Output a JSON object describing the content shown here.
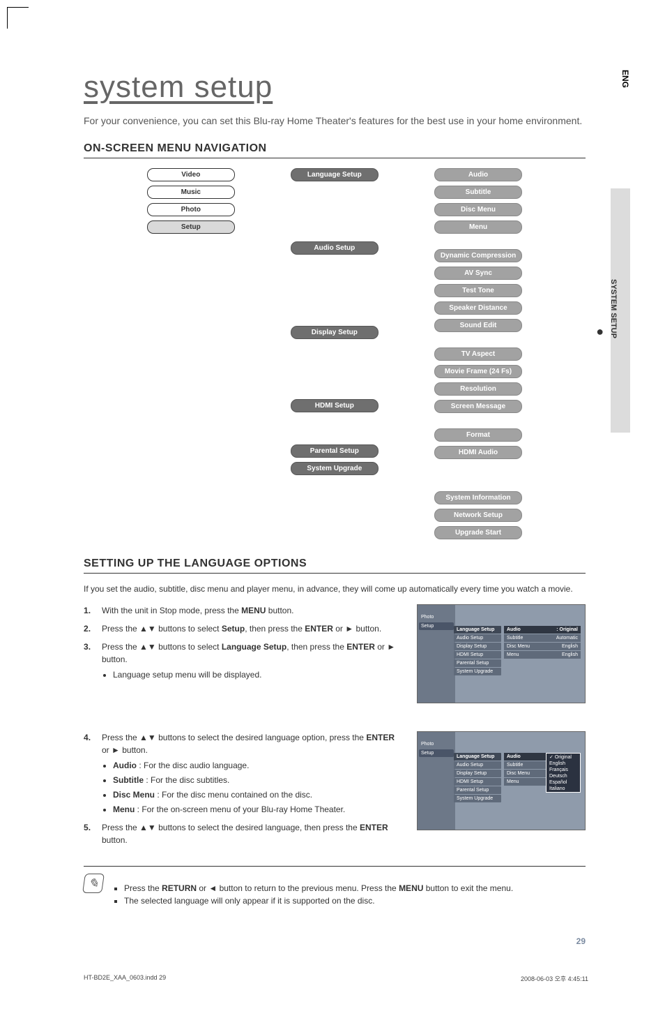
{
  "lang_tab": "ENG",
  "section_tab": "SYSTEM SETUP",
  "title": "system setup",
  "intro": "For your convenience, you can set this Blu-ray Home Theater's features for the best use in your home environment.",
  "h1": "ON-SCREEN MENU NAVIGATION",
  "nav": {
    "col1": [
      "Video",
      "Music",
      "Photo",
      "Setup"
    ],
    "col2": [
      "Language Setup",
      "Audio Setup",
      "Display Setup",
      "HDMI Setup",
      "Parental Setup",
      "System Upgrade"
    ],
    "language_items": [
      "Audio",
      "Subtitle",
      "Disc Menu",
      "Menu"
    ],
    "audio_items": [
      "Dynamic Compression",
      "AV Sync",
      "Test Tone",
      "Speaker Distance",
      "Sound Edit"
    ],
    "display_items": [
      "TV Aspect",
      "Movie Frame (24 Fs)",
      "Resolution",
      "Screen Message"
    ],
    "hdmi_items": [
      "Format",
      "HDMI Audio"
    ],
    "system_items": [
      "System Information",
      "Network Setup",
      "Upgrade Start"
    ]
  },
  "h2": "SETTING UP THE LANGUAGE OPTIONS",
  "lang_intro": "If you set the audio, subtitle, disc menu and player menu, in advance, they will come up automatically every time you watch a movie.",
  "steps": {
    "s1_a": "With the unit in Stop mode, press the ",
    "s1_b": "MENU",
    "s1_c": " button.",
    "s2_a": "Press the ▲▼ buttons to select ",
    "s2_b": "Setup",
    "s2_c": ", then press the ",
    "s2_d": "ENTER",
    "s2_e": " or ► button.",
    "s3_a": "Press the ▲▼ buttons to select ",
    "s3_b": "Language Setup",
    "s3_c": ", then press the ",
    "s3_d": "ENTER",
    "s3_e": " or ► button.",
    "s3_sub": "Language setup menu will be displayed.",
    "s4_a": "Press the ▲▼ buttons to select the desired language option, press the ",
    "s4_b": "ENTER",
    "s4_c": " or ► button.",
    "s4_sub1_b": "Audio",
    "s4_sub1_t": " : For the disc audio language.",
    "s4_sub2_b": "Subtitle",
    "s4_sub2_t": " : For the disc subtitles.",
    "s4_sub3_b": "Disc Menu",
    "s4_sub3_t": " : For the disc menu contained on the disc.",
    "s4_sub4_b": "Menu",
    "s4_sub4_t": " : For the on-screen menu of your Blu-ray Home Theater.",
    "s5_a": "Press the ▲▼ buttons to select the desired language, then press the ",
    "s5_b": "ENTER",
    "s5_c": " button."
  },
  "shot": {
    "left": [
      "Photo",
      "Setup"
    ],
    "mid": [
      "Language Setup",
      "Audio Setup",
      "Display Setup",
      "HDMI Setup",
      "Parental Setup",
      "System Upgrade"
    ],
    "right1": [
      {
        "k": "Audio",
        "v": ": Original"
      },
      {
        "k": "Subtitle",
        "v": "Automatic"
      },
      {
        "k": "Disc Menu",
        "v": "English"
      },
      {
        "k": "Menu",
        "v": "English"
      }
    ],
    "right2": [
      {
        "k": "Audio",
        "v": ""
      },
      {
        "k": "Subtitle",
        "v": ""
      },
      {
        "k": "Disc Menu",
        "v": ""
      },
      {
        "k": "Menu",
        "v": ""
      }
    ],
    "dropdown": [
      "Original",
      "English",
      "Français",
      "Deutsch",
      "Español",
      "Italiano"
    ]
  },
  "notes": {
    "n1_a": "Press the ",
    "n1_b": "RETURN",
    "n1_c": " or ◄ button to return to the previous menu. Press the ",
    "n1_d": "MENU",
    "n1_e": " button to exit the menu.",
    "n2": "The selected language will only appear if it is supported on the disc."
  },
  "page_number": "29",
  "footer_left": "HT-BD2E_XAA_0603.indd   29",
  "footer_right": "2008-06-03   오후 4:45:11"
}
